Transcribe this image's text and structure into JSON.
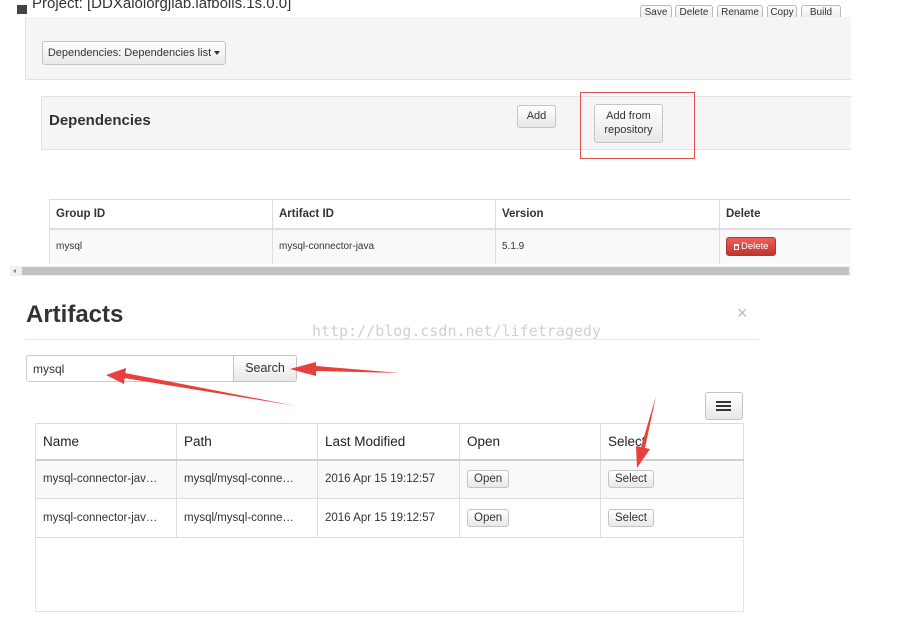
{
  "window": {
    "project_title": "Project: [DDXaiolorgjlab.lafbolls.1s.0.0]",
    "top_buttons": [
      "Save",
      "Delete",
      "Rename",
      "Copy",
      "Build"
    ]
  },
  "dependencies_panel": {
    "dropdown_label": "Dependencies: Dependencies list",
    "title": "Dependencies",
    "add_label": "Add",
    "add_from_repo_label": "Add from repository",
    "columns": [
      "Group ID",
      "Artifact ID",
      "Version",
      "Delete"
    ],
    "rows": [
      {
        "group_id": "mysql",
        "artifact_id": "mysql-connector-java",
        "version": "5.1.9",
        "delete_label": "Delete"
      }
    ]
  },
  "artifacts_modal": {
    "title": "Artifacts",
    "close_glyph": "×",
    "watermark": "http://blog.csdn.net/lifetragedy",
    "search_value": "mysql",
    "search_label": "Search",
    "columns": [
      "Name",
      "Path",
      "Last Modified",
      "Open",
      "Select"
    ],
    "rows": [
      {
        "name": "mysql-connector-jav…",
        "path": "mysql/mysql-conne…",
        "modified": "2016 Apr 15 19:12:57",
        "open_label": "Open",
        "select_label": "Select"
      },
      {
        "name": "mysql-connector-jav…",
        "path": "mysql/mysql-conne…",
        "modified": "2016 Apr 15 19:12:57",
        "open_label": "Open",
        "select_label": "Select"
      }
    ]
  },
  "colors": {
    "annotation_red": "#e8403a",
    "delete_red": "#d9534f",
    "panel_bg": "#f5f5f5"
  },
  "icons": [
    "caret-down-icon",
    "trash-icon",
    "close-icon",
    "list-icon",
    "annotation-arrow"
  ]
}
